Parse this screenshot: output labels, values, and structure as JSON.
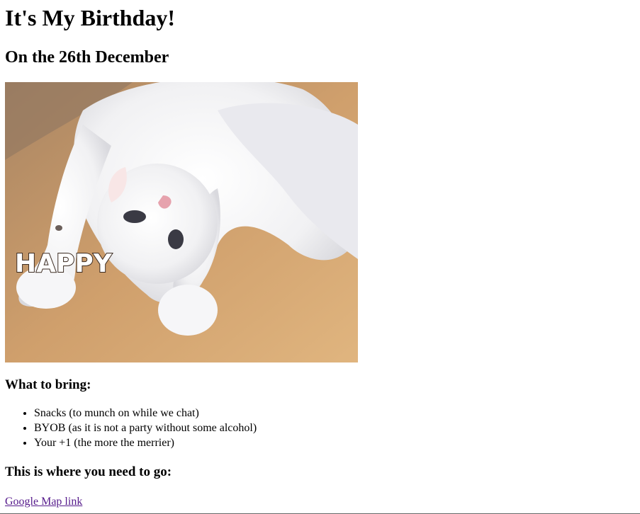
{
  "heading": "It's My Birthday!",
  "subheading": "On the 26th December",
  "image": {
    "overlay_text": "HAPPY"
  },
  "bring": {
    "title": "What to bring:",
    "items": [
      "Snacks (to munch on while we chat)",
      "BYOB (as it is not a party without some alcohol)",
      "Your +1 (the more the merrier)"
    ]
  },
  "location": {
    "title": "This is where you need to go:",
    "link_text": "Google Map link",
    "link_color": "#551a8b"
  }
}
